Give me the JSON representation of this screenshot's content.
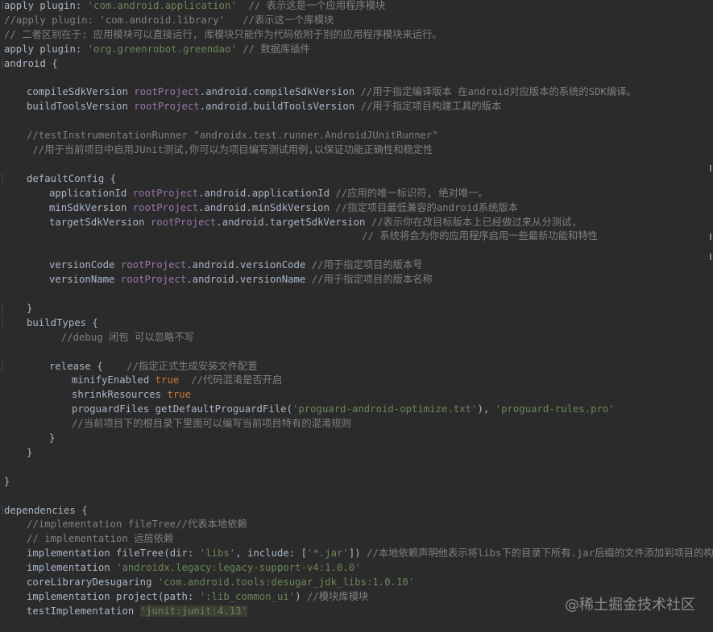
{
  "editor": {
    "lines": [
      {
        "indent": 0,
        "tokens": [
          {
            "t": "apply ",
            "c": "plain"
          },
          {
            "t": "plugin",
            "c": "plain"
          },
          {
            "t": ": ",
            "c": "plain"
          },
          {
            "t": "'com.android.application'",
            "c": "str"
          },
          {
            "t": "  // 表示这是一个应用程序模块",
            "c": "cmt"
          }
        ]
      },
      {
        "indent": 0,
        "tokens": [
          {
            "t": "//apply plugin: 'com.android.library'   //表示这一个库模块",
            "c": "cmt"
          }
        ]
      },
      {
        "indent": 0,
        "tokens": [
          {
            "t": "// 二者区别在于: 应用模块可以直接运行, 库模块只能作为代码依附于别的应用程序模块来运行。",
            "c": "cmt"
          }
        ]
      },
      {
        "indent": 0,
        "tokens": [
          {
            "t": "apply ",
            "c": "plain"
          },
          {
            "t": "plugin",
            "c": "plain"
          },
          {
            "t": ": ",
            "c": "plain"
          },
          {
            "t": "'org.greenrobot.greendao'",
            "c": "str"
          },
          {
            "t": " // 数据库插件",
            "c": "cmt"
          }
        ]
      },
      {
        "indent": 0,
        "tokens": [
          {
            "t": "android {",
            "c": "plain"
          }
        ]
      },
      {
        "indent": 0,
        "tokens": []
      },
      {
        "indent": 1,
        "tokens": [
          {
            "t": "compileSdkVersion ",
            "c": "plain"
          },
          {
            "t": "rootProject",
            "c": "prop"
          },
          {
            "t": ".android.compileSdkVersion ",
            "c": "plain"
          },
          {
            "t": "//用于指定编译版本 在android对应版本的系统的SDK编译。",
            "c": "cmt"
          }
        ]
      },
      {
        "indent": 1,
        "tokens": [
          {
            "t": "buildToolsVersion ",
            "c": "plain"
          },
          {
            "t": "rootProject",
            "c": "prop"
          },
          {
            "t": ".android.buildToolsVersion ",
            "c": "plain"
          },
          {
            "t": "//用于指定项目构建工具的版本",
            "c": "cmt"
          }
        ]
      },
      {
        "indent": 0,
        "tokens": []
      },
      {
        "indent": 1,
        "tokens": [
          {
            "t": "//testInstrumentationRunner \"androidx.test.runner.AndroidJUnitRunner\"",
            "c": "cmt"
          }
        ]
      },
      {
        "indent": 1,
        "tokens": [
          {
            "t": " //用于当前项目中启用JUnit测试,你可以为项目编写测试用例,以保证功能正确性和稳定性",
            "c": "cmt"
          }
        ]
      },
      {
        "indent": 0,
        "tokens": []
      },
      {
        "indent": 1,
        "tokens": [
          {
            "t": "defaultConfig {",
            "c": "plain"
          }
        ]
      },
      {
        "indent": 2,
        "tokens": [
          {
            "t": "applicationId ",
            "c": "plain"
          },
          {
            "t": "rootProject",
            "c": "prop"
          },
          {
            "t": ".android.applicationId ",
            "c": "plain"
          },
          {
            "t": "//应用的唯一标识符, 绝对唯一。",
            "c": "cmt"
          }
        ]
      },
      {
        "indent": 2,
        "tokens": [
          {
            "t": "minSdkVersion ",
            "c": "plain"
          },
          {
            "t": "rootProject",
            "c": "prop"
          },
          {
            "t": ".android.minSdkVersion ",
            "c": "plain"
          },
          {
            "t": "//指定项目最低兼容的android系统版本",
            "c": "cmt"
          }
        ]
      },
      {
        "indent": 2,
        "tokens": [
          {
            "t": "targetSdkVersion ",
            "c": "plain"
          },
          {
            "t": "rootProject",
            "c": "prop"
          },
          {
            "t": ".android.targetSdkVersion ",
            "c": "plain"
          },
          {
            "t": "//表示你在改目标版本上已经做过来从分测试,",
            "c": "cmt"
          }
        ]
      },
      {
        "indent": 0,
        "tokens": [
          {
            "t": "                                                            // 系统将会为你的应用程序启用一些最新功能和特性",
            "c": "cmt"
          }
        ]
      },
      {
        "indent": 0,
        "tokens": []
      },
      {
        "indent": 2,
        "tokens": [
          {
            "t": "versionCode ",
            "c": "plain"
          },
          {
            "t": "rootProject",
            "c": "prop"
          },
          {
            "t": ".android.versionCode ",
            "c": "plain"
          },
          {
            "t": "//用于指定项目的版本号",
            "c": "cmt"
          }
        ]
      },
      {
        "indent": 2,
        "tokens": [
          {
            "t": "versionName ",
            "c": "plain"
          },
          {
            "t": "rootProject",
            "c": "prop"
          },
          {
            "t": ".android.versionName ",
            "c": "plain"
          },
          {
            "t": "//用于指定项目的版本名称",
            "c": "cmt"
          }
        ]
      },
      {
        "indent": 0,
        "tokens": []
      },
      {
        "indent": 1,
        "tokens": [
          {
            "t": "}",
            "c": "plain"
          }
        ]
      },
      {
        "indent": 1,
        "tokens": [
          {
            "t": "buildTypes {",
            "c": "plain"
          }
        ]
      },
      {
        "indent": 2,
        "tokens": [
          {
            "t": "  //debug 闭包 可以忽略不写",
            "c": "cmt"
          }
        ]
      },
      {
        "indent": 0,
        "tokens": []
      },
      {
        "indent": 2,
        "tokens": [
          {
            "t": "release {    ",
            "c": "plain"
          },
          {
            "t": "//指定正式生成安装文件配置",
            "c": "cmt"
          }
        ]
      },
      {
        "indent": 3,
        "tokens": [
          {
            "t": "minifyEnabled ",
            "c": "plain"
          },
          {
            "t": "true",
            "c": "key"
          },
          {
            "t": "  //代码混淆是否开启",
            "c": "cmt"
          }
        ]
      },
      {
        "indent": 3,
        "tokens": [
          {
            "t": "shrinkResources ",
            "c": "plain"
          },
          {
            "t": "true",
            "c": "key"
          }
        ]
      },
      {
        "indent": 3,
        "tokens": [
          {
            "t": "proguardFiles getDefaultProguardFile(",
            "c": "plain"
          },
          {
            "t": "'proguard-android-optimize.txt'",
            "c": "str"
          },
          {
            "t": "), ",
            "c": "plain"
          },
          {
            "t": "'proguard-rules.pro'",
            "c": "str"
          }
        ]
      },
      {
        "indent": 3,
        "tokens": [
          {
            "t": "//当前项目下的根目录下里面可以编写当前项目特有的混淆规则",
            "c": "cmt"
          }
        ]
      },
      {
        "indent": 2,
        "tokens": [
          {
            "t": "}",
            "c": "plain"
          }
        ]
      },
      {
        "indent": 1,
        "tokens": [
          {
            "t": "}",
            "c": "plain"
          }
        ]
      },
      {
        "indent": 0,
        "tokens": []
      },
      {
        "indent": 0,
        "tokens": [
          {
            "t": "}",
            "c": "plain"
          }
        ]
      },
      {
        "indent": 0,
        "tokens": []
      },
      {
        "indent": 0,
        "tokens": [
          {
            "t": "dependencies {",
            "c": "plain"
          }
        ]
      },
      {
        "indent": 1,
        "tokens": [
          {
            "t": "//implementation fileTree//代表本地依赖",
            "c": "cmt"
          }
        ]
      },
      {
        "indent": 1,
        "tokens": [
          {
            "t": "// implementation 远层依赖",
            "c": "cmt"
          }
        ]
      },
      {
        "indent": 1,
        "tokens": [
          {
            "t": "implementation fileTree(",
            "c": "plain"
          },
          {
            "t": "dir",
            "c": "plain"
          },
          {
            "t": ": ",
            "c": "plain"
          },
          {
            "t": "'libs'",
            "c": "str"
          },
          {
            "t": ", ",
            "c": "plain"
          },
          {
            "t": "include",
            "c": "plain"
          },
          {
            "t": ": [",
            "c": "plain"
          },
          {
            "t": "'*.jar'",
            "c": "str"
          },
          {
            "t": "]) ",
            "c": "plain"
          },
          {
            "t": "//本地依赖声明他表示将libs下的目录下所有.jar后缀的文件添加到项目的构建中",
            "c": "cmt"
          }
        ]
      },
      {
        "indent": 1,
        "tokens": [
          {
            "t": "implementation ",
            "c": "plain"
          },
          {
            "t": "'androidx.legacy:legacy-support-v4:1.0.0'",
            "c": "str"
          }
        ]
      },
      {
        "indent": 1,
        "tokens": [
          {
            "t": "coreLibraryDesugaring ",
            "c": "plain"
          },
          {
            "t": "'com.android.tools:desugar_jdk_libs:1.0.10'",
            "c": "str"
          }
        ]
      },
      {
        "indent": 1,
        "tokens": [
          {
            "t": "implementation project(",
            "c": "plain"
          },
          {
            "t": "path",
            "c": "plain"
          },
          {
            "t": ": ",
            "c": "plain"
          },
          {
            "t": "':lib_common_ui'",
            "c": "str"
          },
          {
            "t": ") ",
            "c": "plain"
          },
          {
            "t": "//模块库模块",
            "c": "cmt"
          }
        ]
      },
      {
        "indent": 1,
        "tokens": [
          {
            "t": "testImplementation ",
            "c": "plain"
          },
          {
            "t": "'junit:junit:4.13'",
            "c": "hl"
          }
        ]
      }
    ]
  },
  "watermark": "@稀土掘金技术社区",
  "colors": {
    "background": "#2b2b2b",
    "plain": "#a9b7c6",
    "keyword": "#cc7832",
    "string": "#6a8759",
    "comment": "#808080",
    "property": "#9876aa"
  }
}
